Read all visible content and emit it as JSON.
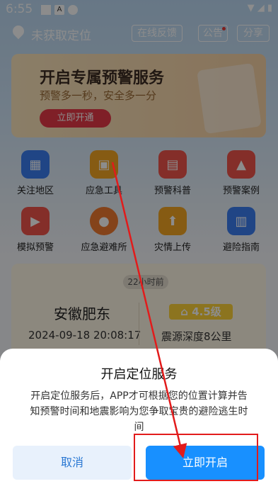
{
  "status": {
    "time": "6:55",
    "notif_letter": "A"
  },
  "topbar": {
    "location": "未获取定位",
    "feedback": "在线反馈",
    "notice": "公告",
    "share": "分享"
  },
  "banner": {
    "title": "开启专属预警服务",
    "subtitle": "预警多一秒，安全多一分",
    "button": "立即开通"
  },
  "grid": [
    {
      "label": "关注地区",
      "icon": "building-icon",
      "color": "#3b7ef3"
    },
    {
      "label": "应急工具",
      "icon": "toolbox-icon",
      "color": "#f5a623"
    },
    {
      "label": "预警科普",
      "icon": "book-icon",
      "color": "#f0554b"
    },
    {
      "label": "预警案例",
      "icon": "alarm-icon",
      "color": "#f0554b"
    },
    {
      "label": "模拟预警",
      "icon": "presentation-icon",
      "color": "#f0554b"
    },
    {
      "label": "应急避难所",
      "icon": "runner-icon",
      "color": "#f07a30"
    },
    {
      "label": "灾情上传",
      "icon": "upload-icon",
      "color": "#f5a623"
    },
    {
      "label": "避险指南",
      "icon": "guide-icon",
      "color": "#3b7ef3"
    }
  ],
  "quake": {
    "ago": "22小时前",
    "place": "安徽肥东",
    "datetime": "2024-09-18 20:08:17",
    "magnitude": "4.5级",
    "depth": "震源深度8公里"
  },
  "dialog": {
    "title": "开启定位服务",
    "desc": "开启定位服务后，APP才可根据您的位置计算并告知预警时间和地震影响为您争取宝贵的避险逃生时间",
    "cancel": "取消",
    "confirm": "立即开启"
  }
}
